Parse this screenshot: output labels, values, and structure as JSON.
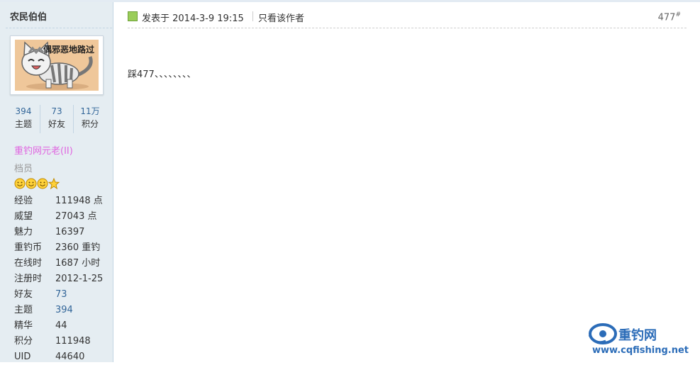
{
  "author": {
    "name": "农民伯伯",
    "avatar_caption": "偶邪恶地路过",
    "stats": [
      {
        "num": "394",
        "label": "主题"
      },
      {
        "num": "73",
        "label": "好友"
      },
      {
        "num": "11万",
        "label": "积分"
      }
    ],
    "group": "重钓网元老(II)",
    "rank": "档员",
    "medal_icons": [
      "smiley-medal-icon",
      "smiley-medal-icon",
      "smiley-medal-icon",
      "star-medal-icon"
    ],
    "profile": [
      {
        "key": "经验",
        "value": "111948 点"
      },
      {
        "key": "威望",
        "value": "27043 点"
      },
      {
        "key": "魅力",
        "value": "16397"
      },
      {
        "key": "重钓币",
        "value": "2360 重钓"
      },
      {
        "key": "在线时",
        "value": "1687 小时"
      },
      {
        "key": "注册时",
        "value": "2012-1-25"
      },
      {
        "key": "好友",
        "value": "73"
      },
      {
        "key": "主题",
        "value": "394"
      },
      {
        "key": "精华",
        "value": "44"
      },
      {
        "key": "积分",
        "value": "111948"
      },
      {
        "key": "UID",
        "value": "44640"
      }
    ]
  },
  "post": {
    "posted_label": "发表于 2014-3-9 19:15",
    "only_author_label": "只看该作者",
    "floor_number": "477",
    "floor_suffix": "#",
    "body": "踩477、、、、、、、、"
  },
  "watermark": {
    "brand": "重钓网",
    "url": "www.cqfishing.net"
  },
  "colors": {
    "sidebar_bg": "#e5edf2",
    "link": "#336699",
    "group": "#e066e0",
    "brand": "#2b6cb8"
  }
}
